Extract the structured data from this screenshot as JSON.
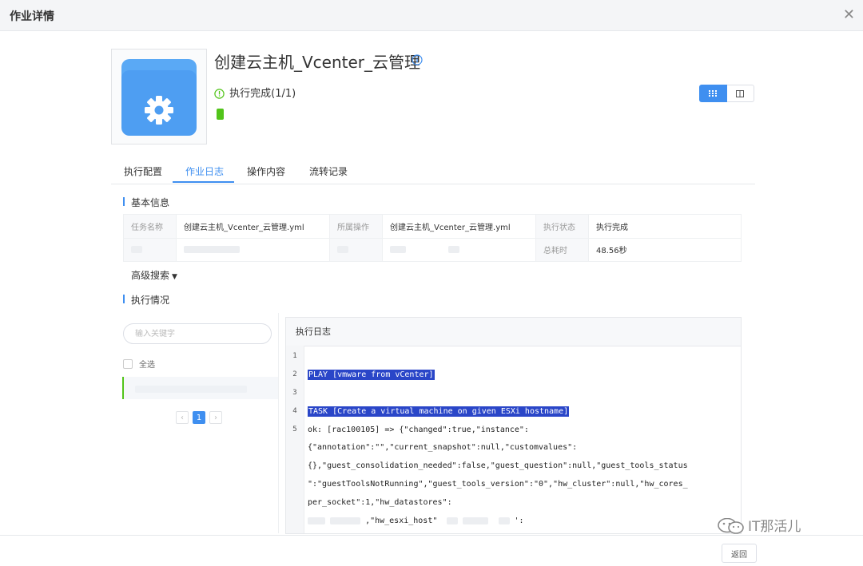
{
  "window": {
    "title": "作业详情"
  },
  "job": {
    "title": "创建云主机_Vcenter_云管理",
    "status_text": "执行完成(1/1)"
  },
  "tabs": [
    {
      "label": "执行配置"
    },
    {
      "label": "作业日志"
    },
    {
      "label": "操作内容"
    },
    {
      "label": "流转记录"
    }
  ],
  "basic_info": {
    "section_title": "基本信息",
    "task_name_key": "任务名称",
    "task_name_value": "创建云主机_Vcenter_云管理.yml",
    "operation_key": "所属操作",
    "operation_value": "创建云主机_Vcenter_云管理.yml",
    "exec_status_key": "执行状态",
    "exec_status_value": "执行完成",
    "duration_key": "总耗时",
    "duration_value": "48.56秒"
  },
  "advanced_search": {
    "label": "高级搜索"
  },
  "exec_section": {
    "title": "执行情况"
  },
  "host_list": {
    "search_placeholder": "输入关键字",
    "select_all": "全选",
    "pagination": {
      "prev": "‹",
      "current": "1",
      "next": "›"
    }
  },
  "log": {
    "header": "执行日志",
    "line_numbers": [
      "1",
      "2",
      "3",
      "4",
      "5"
    ],
    "lines": [
      "",
      "PLAY [vmware from vCenter]",
      "",
      "TASK [Create a virtual machine on given ESXi hostname]",
      "ok: [rac100105] => {\"changed\":true,\"instance\":",
      "{\"annotation\":\"\",\"current_snapshot\":null,\"customvalues\":",
      "{},\"guest_consolidation_needed\":false,\"guest_question\":null,\"guest_tools_status",
      "\":\"guestToolsNotRunning\",\"guest_tools_version\":\"0\",\"hw_cluster\":null,\"hw_cores_",
      "per_socket\":1,\"hw_datastores\":",
      ",\"hw_esxi_host\"",
      "':"
    ]
  },
  "footer": {
    "back_button": "返回"
  },
  "watermark": "IT那活儿",
  "colors": {
    "accent": "#3f8ff0",
    "success": "#52c41a",
    "highlight": "#2a46c8"
  }
}
